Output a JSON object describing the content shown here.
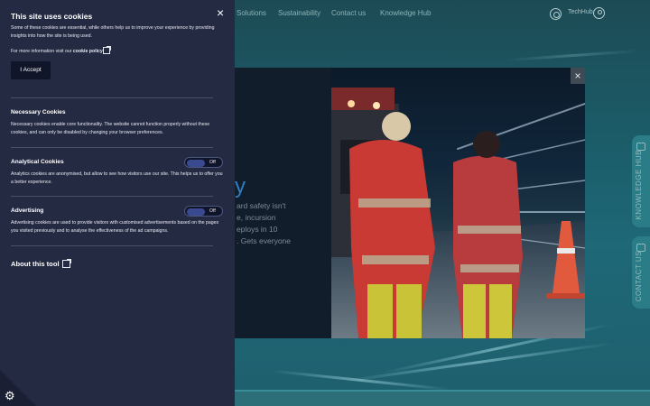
{
  "nav": {
    "links": [
      "Solutions",
      "Sustainability",
      "Contact us",
      "Knowledge Hub"
    ],
    "user_label": "TechHub",
    "icons": {
      "search": "search-icon",
      "account": "user-icon"
    }
  },
  "side_tabs": {
    "knowledge_hub": "KNOWLEDGE HUB",
    "contact_us": "CONTACT US"
  },
  "modal": {
    "heading": "y",
    "lines": [
      "ard safety isn't",
      "e, incursion",
      "eploys in 10",
      ". Gets everyone"
    ],
    "close_label": "×"
  },
  "cookie_panel": {
    "title": "This site uses cookies",
    "close_label": "×",
    "intro": "Some of these cookies are essential, while others help us to improve your experience by providing insights into how the site is being used.",
    "policy_prefix": "For more information visit our",
    "policy_link": "cookie policy",
    "accept_label": "I Accept",
    "necessary": {
      "title": "Necessary Cookies",
      "text": "Necessary cookies enable core functionality. The website cannot function properly without these cookies, and can only be disabled by changing your browser preferences."
    },
    "analytical": {
      "title": "Analytical Cookies",
      "text": "Analytics cookies are anonymised, but allow to see how visitors use our site. This helps us to offer you a better experience.",
      "toggle_state": "Off"
    },
    "advertising": {
      "title": "Advertising",
      "text": "Advertising cookies are used to provide visitors with customised advertisements based on the pages you visited previously and to analyse the effectiveness of the ad campaigns.",
      "toggle_state": "Off"
    },
    "about_label": "About this tool",
    "settings_icon": "gear-icon"
  }
}
